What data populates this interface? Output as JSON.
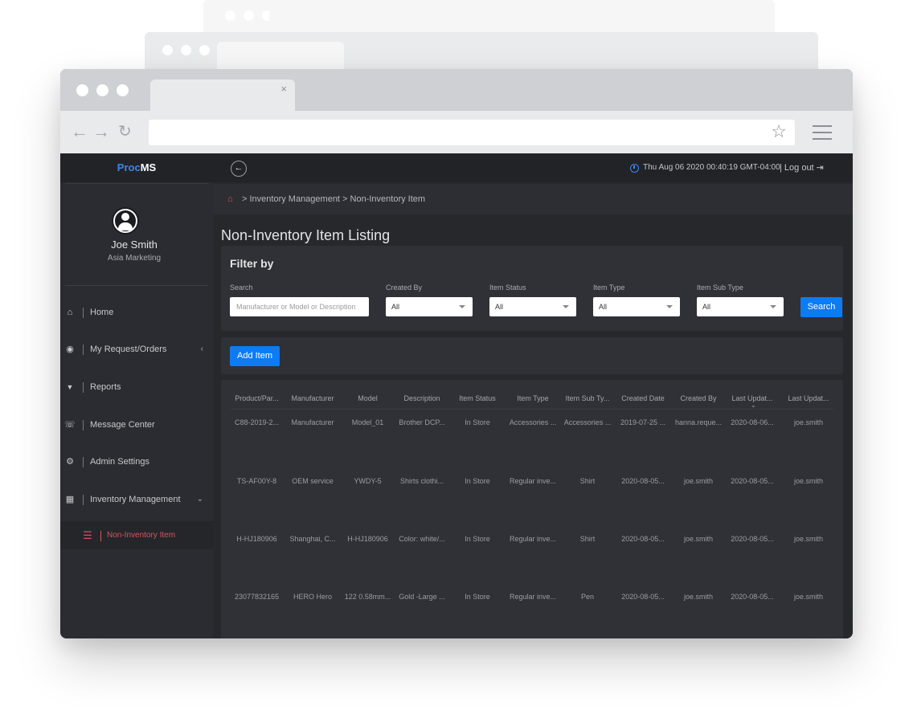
{
  "browser": {
    "tab_close": "×"
  },
  "app": {
    "brand_prefix": "Proc",
    "brand_suffix": "MS"
  },
  "user": {
    "name": "Joe Smith",
    "role": "Asia Marketing"
  },
  "sidebar": {
    "items": [
      {
        "label": "Home",
        "icon": "home-icon",
        "glyph": "⌂"
      },
      {
        "label": "My Request/Orders",
        "icon": "target-icon",
        "glyph": "◉",
        "chevron": "‹"
      },
      {
        "label": "Reports",
        "icon": "filter-icon",
        "glyph": "▼"
      },
      {
        "label": "Message Center",
        "icon": "chat-icon",
        "glyph": "☏"
      },
      {
        "label": "Admin Settings",
        "icon": "gears-icon",
        "glyph": "⚙"
      },
      {
        "label": "Inventory Management",
        "icon": "building-icon",
        "glyph": "▦",
        "chevron": "⌄"
      }
    ],
    "sub_item": {
      "label": "Non-Inventory Item",
      "icon": "list-icon",
      "glyph": "☰"
    }
  },
  "topbar": {
    "back_glyph": "←",
    "datetime": "Thu Aug 06 2020 00:40:19 GMT-04:00",
    "logout": "| Log out ⇥"
  },
  "breadcrumb": {
    "home_glyph": "⌂",
    "items": [
      "Inventory Management",
      "Non-Inventory Item"
    ],
    "text": "> Inventory Management > Non-Inventory Item"
  },
  "page": {
    "title": "Non-Inventory Item Listing"
  },
  "filter": {
    "title": "Filter by",
    "search": {
      "label": "Search",
      "placeholder": "Manufacturer or Model or Description",
      "value": ""
    },
    "created_by": {
      "label": "Created By",
      "value": "All"
    },
    "item_status": {
      "label": "Item Status",
      "value": "All"
    },
    "item_type": {
      "label": "Item Type",
      "value": "All"
    },
    "item_sub_type": {
      "label": "Item Sub Type",
      "value": "All"
    },
    "search_button": "Search"
  },
  "actions": {
    "add_item": "Add Item"
  },
  "table": {
    "columns": [
      "Product/Par...",
      "Manufacturer",
      "Model",
      "Description",
      "Item Status",
      "Item Type",
      "Item Sub Ty...",
      "Created Date",
      "Created By",
      "Last Updat...",
      "Last Updat..."
    ],
    "sort_glyph": "⌄",
    "rows": [
      [
        "C88-2019-2...",
        "Manufacturer",
        "Model_01",
        "Brother DCP...",
        "In Store",
        "Accessories ...",
        "Accessories ...",
        "2019-07-25 ...",
        "hanna.reque...",
        "2020-08-06...",
        "joe.smith"
      ],
      [
        "TS-AF00Y-8",
        "OEM service",
        "YWDY-5",
        "Shirts clothi...",
        "In Store",
        "Regular inve...",
        "Shirt",
        "2020-08-05...",
        "joe.smith",
        "2020-08-05...",
        "joe.smith"
      ],
      [
        "H-HJ180906",
        "Shanghai, C...",
        "H-HJ180906",
        "Color: white/...",
        "In Store",
        "Regular inve...",
        "Shirt",
        "2020-08-05...",
        "joe.smith",
        "2020-08-05...",
        "joe.smith"
      ],
      [
        "23077832165",
        "HERO Hero",
        "122 0.58mm...",
        "Gold -Large ...",
        "In Store",
        "Regular inve...",
        "Pen",
        "2020-08-05...",
        "joe.smith",
        "2020-08-05...",
        "joe.smith"
      ]
    ]
  },
  "colors": {
    "accent_blue": "#0d7bf2",
    "active_red": "#d8545d",
    "sidebar_bg": "#2b2c31",
    "content_bg": "#27282c"
  }
}
